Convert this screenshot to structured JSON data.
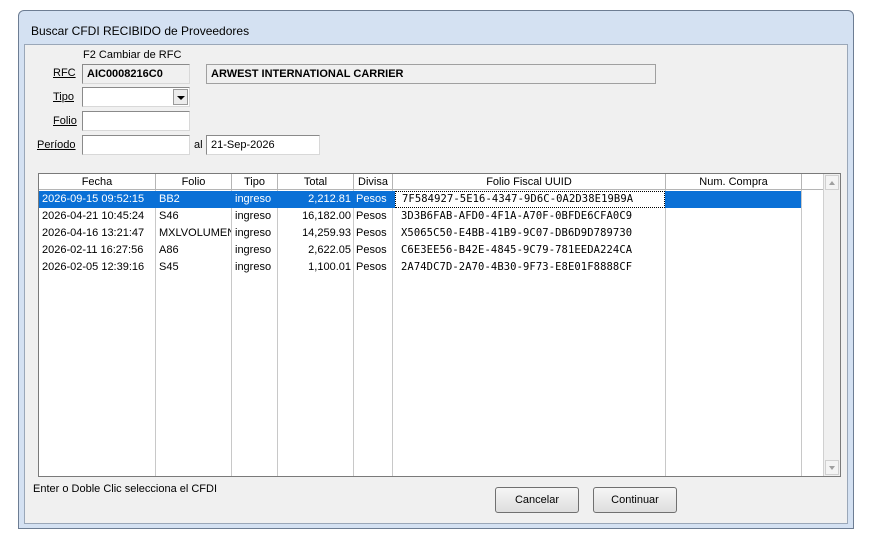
{
  "window": {
    "title": "Buscar CFDI RECIBIDO de Proveedores"
  },
  "form": {
    "rfc_hint": "F2 Cambiar de RFC",
    "rfc_label": "RFC",
    "rfc_value": "AIC0008216C0",
    "rfc_name": "ARWEST INTERNATIONAL CARRIER",
    "tipo_label": "Tipo",
    "tipo_value": "",
    "folio_label": "Folio",
    "folio_value": "",
    "periodo_label": "Período",
    "periodo_from": "",
    "al_label": "al",
    "periodo_to": "21-Sep-2026"
  },
  "table": {
    "columns": [
      "Fecha",
      "Folio",
      "Tipo",
      "Total",
      "Divisa",
      "Folio Fiscal UUID",
      "Num. Compra"
    ],
    "rows": [
      {
        "fecha": "2026-09-15 09:52:15",
        "folio": "BB2",
        "tipo": "ingreso",
        "total": "2,212.81",
        "divisa": "Pesos",
        "uuid": "7F584927-5E16-4347-9D6C-0A2D38E19B9A",
        "num_compra": "",
        "selected": true
      },
      {
        "fecha": "2026-04-21 10:45:24",
        "folio": "S46",
        "tipo": "ingreso",
        "total": "16,182.00",
        "divisa": "Pesos",
        "uuid": "3D3B6FAB-AFD0-4F1A-A70F-0BFDE6CFA0C9",
        "num_compra": "",
        "selected": false
      },
      {
        "fecha": "2026-04-16 13:21:47",
        "folio": "MXLVOLUMEN",
        "tipo": "ingreso",
        "total": "14,259.93",
        "divisa": "Pesos",
        "uuid": "X5065C50-E4BB-41B9-9C07-DB6D9D789730",
        "num_compra": "",
        "selected": false
      },
      {
        "fecha": "2026-02-11 16:27:56",
        "folio": "A86",
        "tipo": "ingreso",
        "total": "2,622.05",
        "divisa": "Pesos",
        "uuid": "C6E3EE56-B42E-4845-9C79-781EEDA224CA",
        "num_compra": "",
        "selected": false
      },
      {
        "fecha": "2026-02-05 12:39:16",
        "folio": "S45",
        "tipo": "ingreso",
        "total": "1,100.01",
        "divisa": "Pesos",
        "uuid": "2A74DC7D-2A70-4B30-9F73-E8E01F8888CF",
        "num_compra": "",
        "selected": false
      }
    ]
  },
  "footer": {
    "hint": "Enter o Doble Clic selecciona el CFDI",
    "cancel_label": "Cancelar",
    "continue_label": "Continuar"
  },
  "colors": {
    "selection": "#0a70d6",
    "window_frame": "#d4e1f2",
    "client_bg": "#f0f0f0"
  },
  "icons": {
    "dropdown": "chevron-down-icon",
    "scroll_up": "scroll-up-icon",
    "scroll_down": "scroll-down-icon"
  }
}
